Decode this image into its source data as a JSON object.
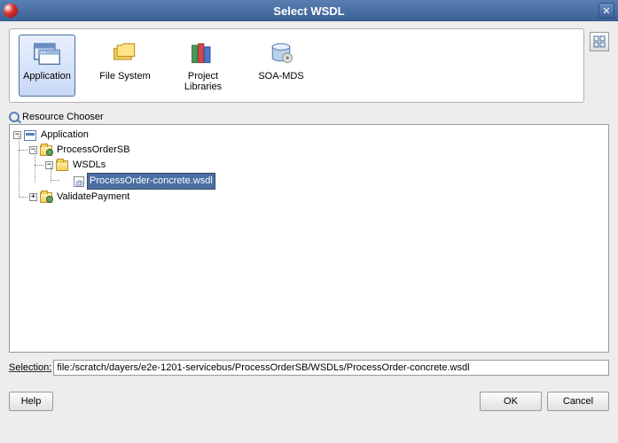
{
  "window": {
    "title": "Select WSDL"
  },
  "sources": {
    "items": [
      {
        "label": "Application",
        "selected": true
      },
      {
        "label": "File System",
        "selected": false
      },
      {
        "label": "Project Libraries",
        "selected": false
      },
      {
        "label": "SOA-MDS",
        "selected": false
      }
    ]
  },
  "chooser": {
    "label": "Resource Chooser"
  },
  "tree": {
    "root": {
      "label": "Application",
      "expanded": true,
      "children": [
        {
          "label": "ProcessOrderSB",
          "expanded": true,
          "children": [
            {
              "label": "WSDLs",
              "expanded": true,
              "children": [
                {
                  "label": "ProcessOrder-concrete.wsdl",
                  "selected": true,
                  "leaf": true
                }
              ]
            }
          ]
        },
        {
          "label": "ValidatePayment",
          "expanded": false,
          "children": []
        }
      ]
    }
  },
  "selection": {
    "label": "Selection:",
    "value": "file:/scratch/dayers/e2e-1201-servicebus/ProcessOrderSB/WSDLs/ProcessOrder-concrete.wsdl"
  },
  "buttons": {
    "help": "Help",
    "ok": "OK",
    "cancel": "Cancel"
  }
}
